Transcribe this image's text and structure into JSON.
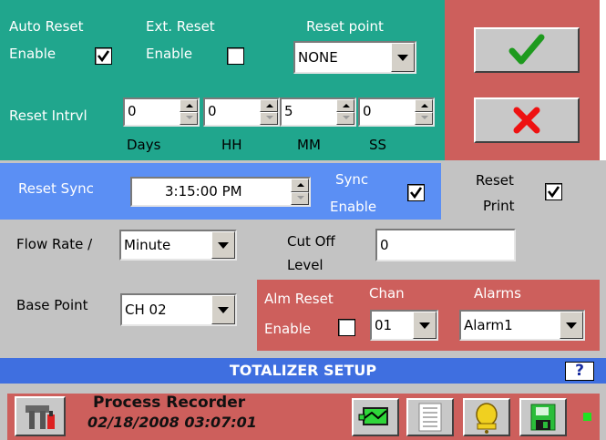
{
  "panel": {
    "auto_reset_line1": "Auto Reset",
    "auto_reset_line2": "Enable",
    "ext_reset_line1": "Ext. Reset",
    "ext_reset_line2": "Enable",
    "reset_point_label": "Reset point",
    "reset_point_value": "NONE",
    "reset_intrvl_label": "Reset Intrvl",
    "interval": [
      {
        "value": "0",
        "unit": "Days"
      },
      {
        "value": "0",
        "unit": "HH"
      },
      {
        "value": "5",
        "unit": "MM"
      },
      {
        "value": "0",
        "unit": "SS"
      }
    ],
    "reset_sync_label": "Reset Sync",
    "reset_sync_value": "3:15:00 PM",
    "sync_enable_line1": "Sync",
    "sync_enable_line2": "Enable",
    "reset_print_line1": "Reset",
    "reset_print_line2": "Print",
    "flow_rate_label": "Flow Rate /",
    "flow_rate_value": "Minute",
    "cut_off_line1": "Cut Off",
    "cut_off_line2": "Level",
    "cut_off_value": "0",
    "base_point_label": "Base Point",
    "base_point_value": "CH 02",
    "alm_reset_line1": "Alm Reset",
    "alm_reset_line2": "Enable",
    "chan_label": "Chan",
    "chan_value": "01",
    "alarms_label": "Alarms",
    "alarms_value": "Alarm1"
  },
  "checks": {
    "auto_reset_enable": true,
    "ext_reset_enable": false,
    "sync_enable": true,
    "reset_print": true,
    "alm_reset_enable": false
  },
  "title": "TOTALIZER SETUP",
  "help_label": "?",
  "status": {
    "app_name": "Process Recorder",
    "datetime": "02/18/2008 03:07:01"
  },
  "colors": {
    "teal_panel": "#20a68d",
    "red_panel": "#cd5f5c",
    "blue_panel": "#5b8ff4",
    "title_bar": "#3f6fe0",
    "status_indicator": "#22e022"
  },
  "icons": [
    "ok-check-icon",
    "cancel-x-icon",
    "tools-icon",
    "trend-icon",
    "list-icon",
    "alarm-bell-icon",
    "save-disk-icon"
  ]
}
